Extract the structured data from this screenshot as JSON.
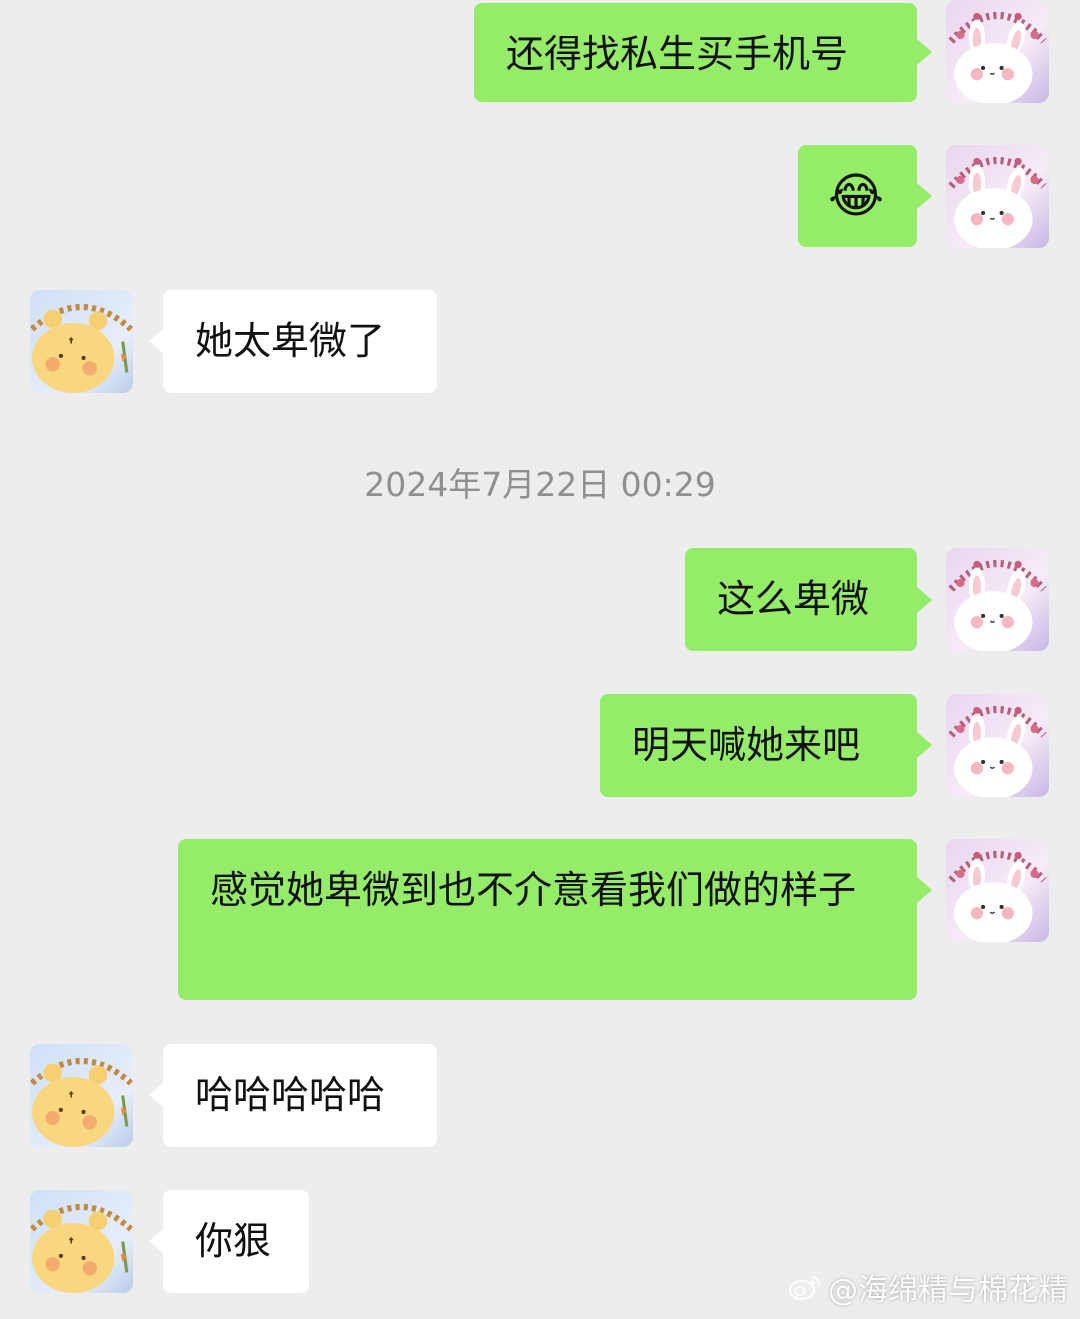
{
  "messages": [
    {
      "side": "sent",
      "text": "还得找私生买手机号"
    },
    {
      "side": "sent",
      "text": "😂",
      "icon": "tears-of-joy-emoji"
    },
    {
      "side": "recv",
      "text": "她太卑微了"
    },
    {
      "side": "sent",
      "text": "这么卑微"
    },
    {
      "side": "sent",
      "text": "明天喊她来吧"
    },
    {
      "side": "sent",
      "text": "感觉她卑微到也不介意看我们做的样子"
    },
    {
      "side": "recv",
      "text": "哈哈哈哈哈"
    },
    {
      "side": "recv",
      "text": "你狠"
    }
  ],
  "timestamp": "2024年7月22日 00:29",
  "watermark": "@海绵精与棉花精",
  "colors": {
    "background": "#ededed",
    "sent_bubble": "#95ec69",
    "recv_bubble": "#ffffff",
    "timestamp": "#8f8f8f"
  },
  "avatars": {
    "self": "bunny-avatar",
    "other": "bear-avatar"
  }
}
